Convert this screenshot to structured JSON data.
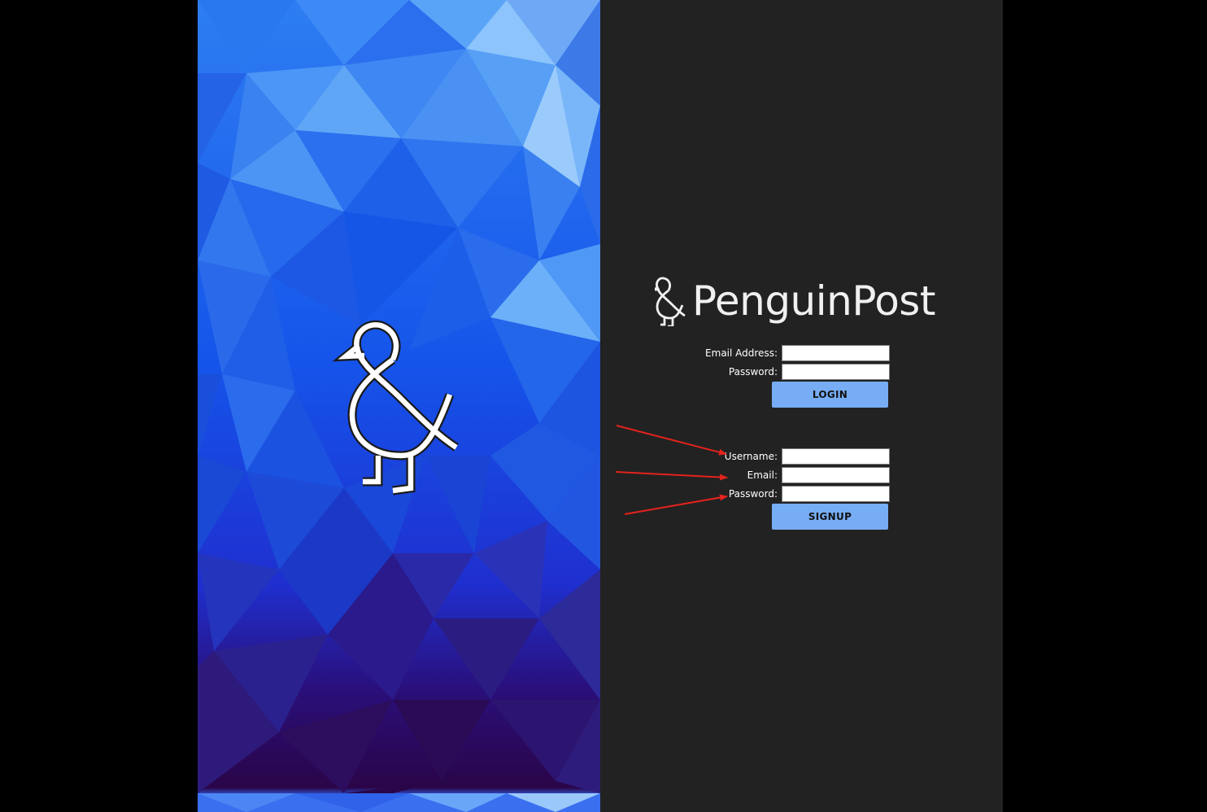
{
  "brand": {
    "name": "PenguinPost",
    "logo_icon": "ampersand-bird-icon"
  },
  "login_form": {
    "email_label": "Email Address:",
    "email_value": "",
    "password_label": "Password:",
    "password_value": "",
    "submit_label": "LOGIN"
  },
  "signup_form": {
    "username_label": "Username:",
    "username_value": "",
    "email_label": "Email:",
    "email_value": "",
    "password_label": "Password:",
    "password_value": "",
    "submit_label": "SIGNUP"
  },
  "annotations": {
    "arrow_color": "#e3231c",
    "arrows": [
      "arrow-to-username",
      "arrow-to-email",
      "arrow-to-password"
    ]
  },
  "theme": {
    "background": "#000000",
    "panel": "#222222",
    "button": "#77adf4",
    "hero_gradient": [
      "#1456e8",
      "#2a0848"
    ]
  }
}
